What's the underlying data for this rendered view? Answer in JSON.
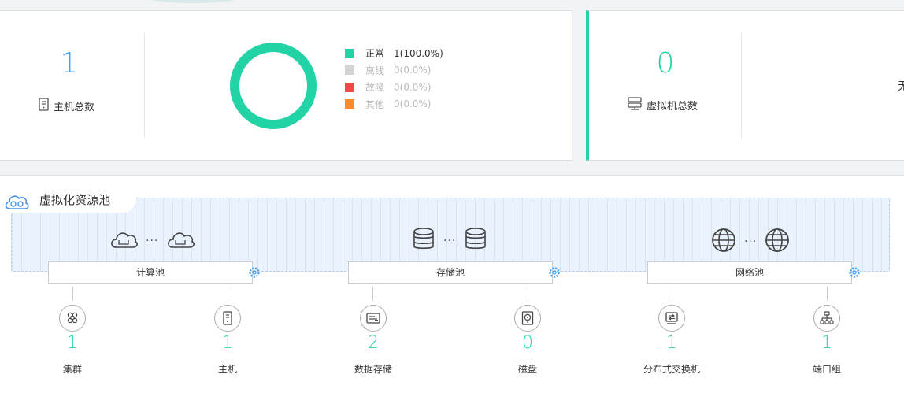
{
  "colors": {
    "accent_green": "#22d3a5",
    "accent_blue": "#409eff",
    "offline": "#d3d3d3",
    "fault": "#f24848",
    "other": "#ff8a2a"
  },
  "host_summary": {
    "total": "1",
    "total_label": "主机总数",
    "legend": [
      {
        "name": "正常",
        "value": "1(100.0%)",
        "color": "#22d3a5"
      },
      {
        "name": "离线",
        "value": "0(0.0%)",
        "color": "#d3d3d3"
      },
      {
        "name": "故障",
        "value": "0(0.0%)",
        "color": "#f24848"
      },
      {
        "name": "其他",
        "value": "0(0.0%)",
        "color": "#ff8a2a"
      }
    ]
  },
  "vm_summary": {
    "total": "0",
    "total_label": "虚拟机总数",
    "cut_text": "无"
  },
  "pool": {
    "title": "虚拟化资源池",
    "dots": "···",
    "groups": [
      {
        "name": "计算池",
        "icon": "cloud-icon"
      },
      {
        "name": "存储池",
        "icon": "database-icon"
      },
      {
        "name": "网络池",
        "icon": "globe-icon"
      }
    ],
    "items": [
      {
        "label": "集群",
        "value": "1",
        "icon": "cluster-icon"
      },
      {
        "label": "主机",
        "value": "1",
        "icon": "server-icon"
      },
      {
        "label": "数据存储",
        "value": "2",
        "icon": "datastore-icon"
      },
      {
        "label": "磁盘",
        "value": "0",
        "icon": "disk-icon"
      },
      {
        "label": "分布式交换机",
        "value": "1",
        "icon": "switch-icon"
      },
      {
        "label": "端口组",
        "value": "1",
        "icon": "portgroup-icon"
      }
    ]
  }
}
